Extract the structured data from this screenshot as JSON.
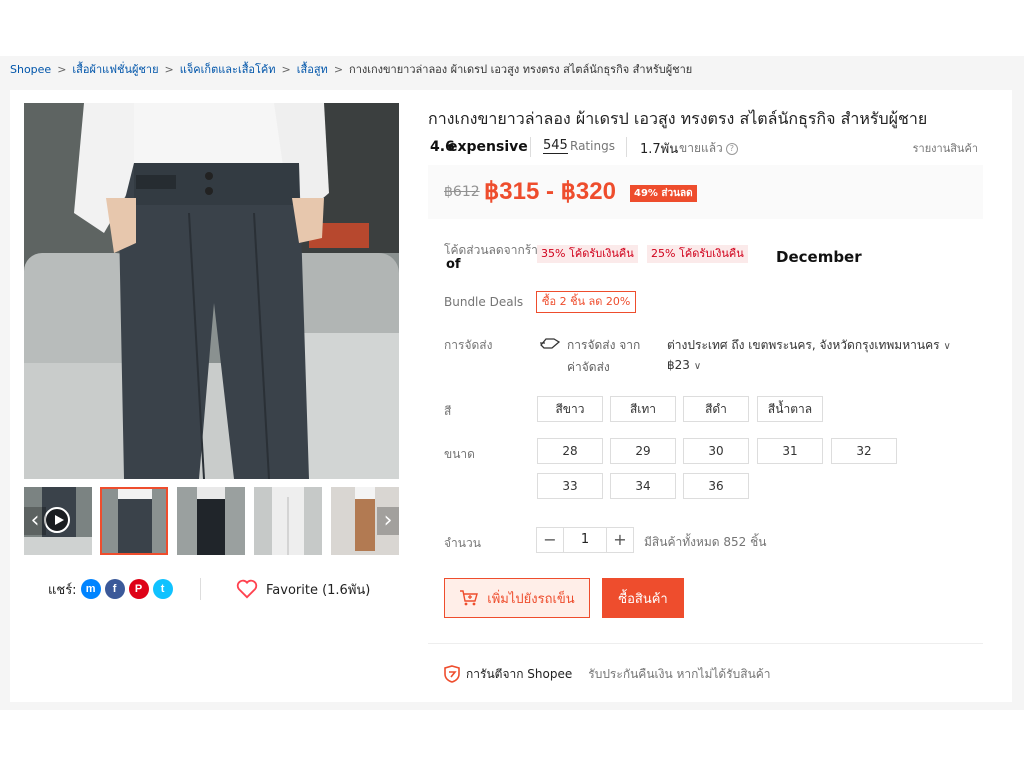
{
  "breadcrumb": {
    "items": [
      "Shopee",
      "เสื้อผ้าแฟชั่นผู้ชาย",
      "แจ็คเก็ตและเสื้อโค้ท",
      "เสื้อสูท"
    ],
    "current": "กางเกงขายาวล่าลอง ผ้าเดรป เอวสูง ทรงตรง สไตล์นักธุรกิจ สำหรับผู้ชาย"
  },
  "product": {
    "title": "กางเกงขายาวล่าลอง ผ้าเดรป เอวสูง ทรงตรง สไตล์นักธุรกิจ สำหรับผู้ชาย",
    "rating": "4.6",
    "overlay_rating_word": "expensive",
    "ratings_count": "545",
    "ratings_label": "Ratings",
    "sold_count": "1.7พัน",
    "sold_label": "ขายแล้ว",
    "report_label": "รายงานสินค้า"
  },
  "price": {
    "original": "฿612",
    "range": "฿315 - ฿320",
    "discount_badge": "49% ส่วนลด"
  },
  "vouchers": {
    "label": "โค้ดส่วนลดจากร้าน",
    "overlay_label": "of",
    "items": [
      "35% โค้ดรับเงินคืน",
      "25% โค้ดรับเงินคืน"
    ],
    "overlay_word": "December"
  },
  "bundle": {
    "label": "Bundle Deals",
    "deal": "ซื้อ 2 ชิ้น ลด 20%"
  },
  "shipping": {
    "label": "การจัดส่ง",
    "from_label": "การจัดส่ง จาก",
    "from_value": "ต่างประเทศ ถึง เขตพระนคร, จังหวัดกรุงเทพมหานคร",
    "cost_label": "ค่าจัดส่ง",
    "cost_value": "฿23"
  },
  "color": {
    "label": "สี",
    "options": [
      "สีขาว",
      "สีเทา",
      "สีดำ",
      "สีน้ำตาล"
    ]
  },
  "size": {
    "label": "ขนาด",
    "options": [
      "28",
      "29",
      "30",
      "31",
      "32",
      "33",
      "34",
      "36"
    ]
  },
  "quantity": {
    "label": "จำนวน",
    "value": "1",
    "minus": "−",
    "plus": "+",
    "stock": "มีสินค้าทั้งหมด 852 ชิ้น"
  },
  "actions": {
    "add_to_cart": "เพิ่มไปยังรถเข็น",
    "buy_now": "ซื้อสินค้า"
  },
  "share": {
    "label": "แชร์:",
    "favorite": "Favorite (1.6พัน)"
  },
  "guarantee": {
    "title": "การันตีจาก Shopee",
    "desc": "รับประกันคืนเงิน หากไม่ได้รับสินค้า"
  },
  "colors": {
    "accent": "#ee4d2d",
    "link": "#0055aa"
  }
}
